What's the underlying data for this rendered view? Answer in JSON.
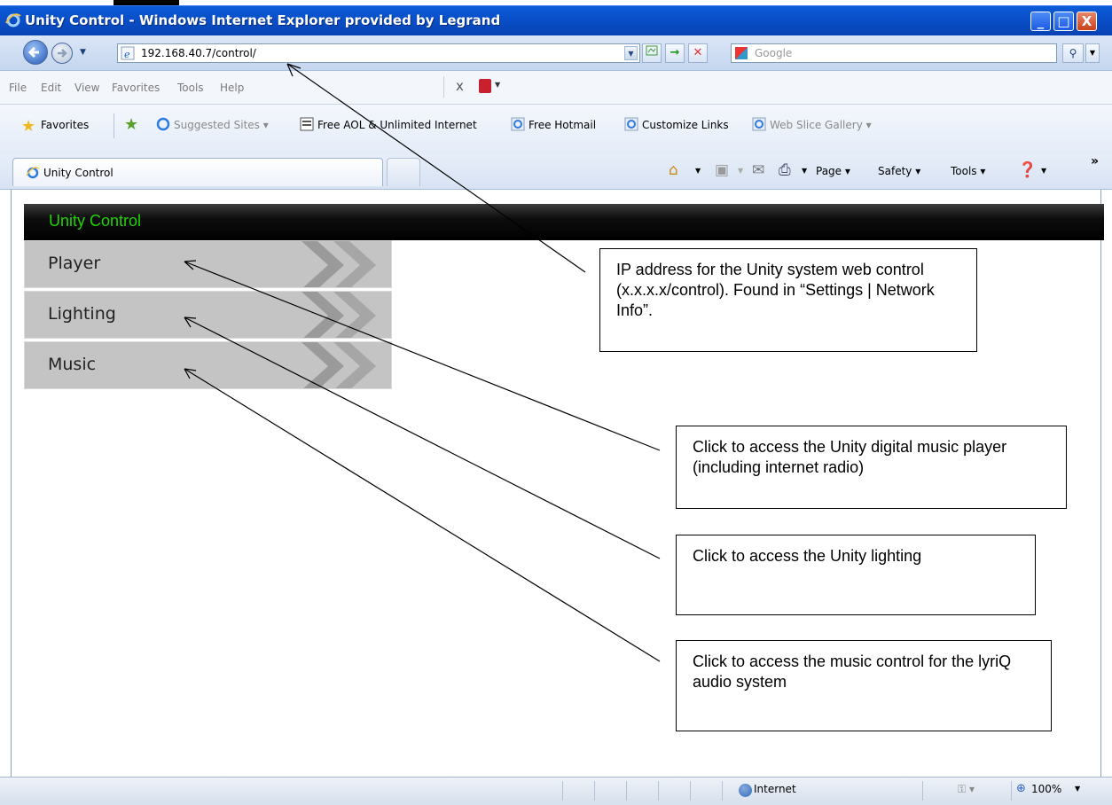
{
  "window": {
    "title": "Unity Control - Windows Internet Explorer provided by Legrand",
    "buttons": {
      "minimize": "_",
      "maximize": "□",
      "close": "X"
    }
  },
  "address_bar": {
    "url": "192.168.40.7/control/",
    "search_placeholder": "Google"
  },
  "menu": {
    "items": [
      "File",
      "Edit",
      "View",
      "Favorites",
      "Tools",
      "Help"
    ],
    "close_glyph": "x"
  },
  "favorites_bar": {
    "label": "Favorites",
    "links": [
      "Suggested Sites ▾",
      "Free AOL & Unlimited Internet",
      "Free Hotmail",
      "Customize Links",
      "Web Slice Gallery ▾"
    ]
  },
  "tab": {
    "title": "Unity Control"
  },
  "command_bar": {
    "page": "Page ▾",
    "safety": "Safety ▾",
    "tools": "Tools ▾",
    "overflow": "»"
  },
  "page": {
    "header": "Unity Control",
    "menu_buttons": [
      "Player",
      "Lighting",
      "Music"
    ]
  },
  "callouts": {
    "ip": "IP address for the Unity system web control (x.x.x.x/control).  Found in “Settings | Network Info”.",
    "player": "Click to access the Unity digital music player (including internet radio)",
    "lighting": "Click  to access the Unity lighting",
    "music": "Click to access the music control for the lyriQ audio system"
  },
  "status_bar": {
    "zone": "Internet",
    "zoom": "100%"
  },
  "colors": {
    "title_bar": "#0a52cc",
    "unity_header_text": "#1fd400",
    "menu_button_bg": "#c4c4c4"
  }
}
